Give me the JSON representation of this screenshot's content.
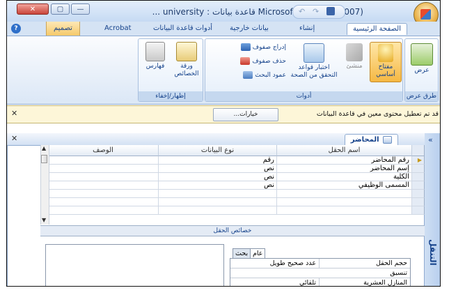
{
  "window": {
    "title": "Microsoft - (Access 2007) قاعدة بيانات : university ...",
    "controls": {
      "minimize": "—",
      "maximize": "▢",
      "close": "✕"
    }
  },
  "tabs": {
    "items": [
      "الصفحة الرئيسية",
      "إنشاء",
      "بيانات خارجية",
      "أدوات قاعدة البيانات",
      "Acrobat"
    ],
    "contextual": "تصميم"
  },
  "ribbon": {
    "views_group": {
      "view_label": "عرض",
      "group_label": "طرق عرض"
    },
    "tools_group": {
      "primary_key": "مفتاح أساسي",
      "builder": "منشئ",
      "test_rules": "اختبار قواعد التحقق من الصحة",
      "insert_rows": "إدراج صفوف",
      "delete_rows": "حذف صفوف",
      "lookup_column": "عمود البحث",
      "group_label": "أدوات"
    },
    "showhide_group": {
      "property_sheet": "ورقة الخصائص",
      "indexes": "فهارس",
      "group_label": "إظهار/إخفاء"
    }
  },
  "message_bar": {
    "text": "قد تم تعطيل محتوى معين في قاعدة البيانات",
    "options_label": "خيارات..."
  },
  "navigation_pane": {
    "label": "التنقل",
    "collapse": "«"
  },
  "document": {
    "tab_title": "المحاضر",
    "columns": [
      "اسم الحقل",
      "نوع البيانات",
      "الوصف"
    ],
    "rows": [
      {
        "field": "رقم المحاضر",
        "type": "رقم",
        "desc": ""
      },
      {
        "field": "إسم المحاضر",
        "type": "نص",
        "desc": ""
      },
      {
        "field": "الكلية",
        "type": "نص",
        "desc": ""
      },
      {
        "field": "المسمى الوظيفي",
        "type": "نص",
        "desc": ""
      },
      {
        "field": "",
        "type": "",
        "desc": ""
      },
      {
        "field": "",
        "type": "",
        "desc": ""
      },
      {
        "field": "",
        "type": "",
        "desc": ""
      }
    ],
    "field_properties_label": "خصائص الحقل",
    "property_tabs": {
      "general": "عام",
      "lookup": "بحث"
    },
    "properties": [
      {
        "name": "حجم الحقل",
        "value": "عدد صحيح طويل"
      },
      {
        "name": "تنسيق",
        "value": ""
      },
      {
        "name": "المنازل العشرية",
        "value": "تلقائي"
      }
    ]
  }
}
